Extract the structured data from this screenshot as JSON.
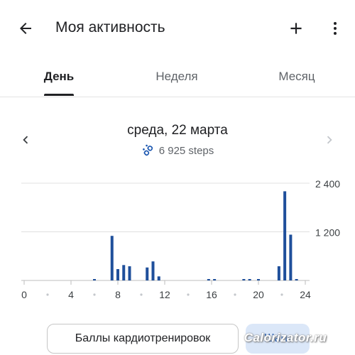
{
  "header": {
    "title": "Моя активность",
    "back_icon": "arrow-left-icon",
    "add_icon": "plus-icon",
    "more_icon": "more-vert-icon"
  },
  "tabs": [
    {
      "label": "День",
      "active": true
    },
    {
      "label": "Неделя",
      "active": false
    },
    {
      "label": "Месяц",
      "active": false
    }
  ],
  "day": {
    "date": "среда, 22 марта",
    "steps": "6 925 steps",
    "steps_icon": "steps-icon",
    "prev_icon": "chevron-left-icon",
    "next_icon": "chevron-right-icon"
  },
  "chart_data": {
    "type": "bar",
    "x_ticks": [
      "0",
      "4",
      "8",
      "12",
      "16",
      "20",
      "24"
    ],
    "y_ticks": [
      "1 200",
      "2 400"
    ],
    "xlim": [
      0,
      24
    ],
    "ylim": [
      0,
      2400
    ],
    "series_color": "#1f4f9b",
    "bars": [
      {
        "x": 6.0,
        "value": 15
      },
      {
        "x": 7.5,
        "value": 1100
      },
      {
        "x": 8.0,
        "value": 280
      },
      {
        "x": 8.5,
        "value": 380
      },
      {
        "x": 9.0,
        "value": 350
      },
      {
        "x": 10.5,
        "value": 320
      },
      {
        "x": 11.0,
        "value": 470
      },
      {
        "x": 11.5,
        "value": 100
      },
      {
        "x": 15.75,
        "value": 15
      },
      {
        "x": 16.25,
        "value": 15
      },
      {
        "x": 18.75,
        "value": 30
      },
      {
        "x": 19.25,
        "value": 30
      },
      {
        "x": 20.0,
        "value": 15
      },
      {
        "x": 21.75,
        "value": 350
      },
      {
        "x": 22.25,
        "value": 2200
      },
      {
        "x": 22.75,
        "value": 1130
      },
      {
        "x": 23.25,
        "value": 15
      }
    ]
  },
  "chips": {
    "cardio": "Баллы кардиотренировок",
    "steps": "Шаги"
  },
  "watermark": "Calorizator.ru"
}
